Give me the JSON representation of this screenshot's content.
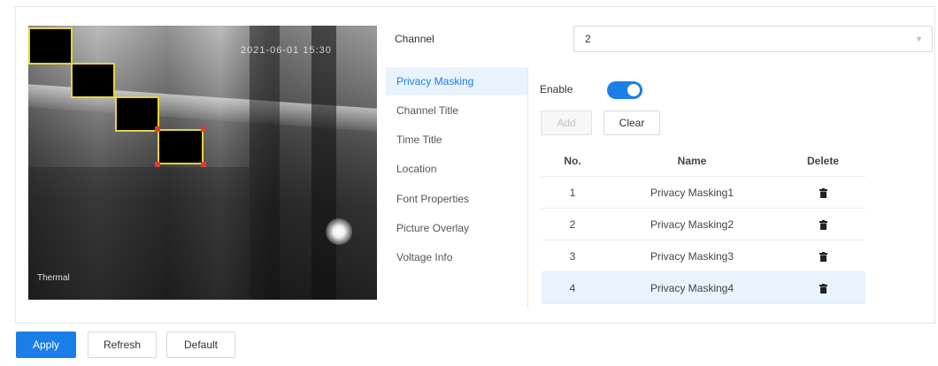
{
  "preview": {
    "osd_time": "2021-06-01 15:30",
    "osd_name": "Thermal",
    "masks": [
      "mask-1",
      "mask-2",
      "mask-3",
      "mask-4"
    ]
  },
  "channel": {
    "label": "Channel",
    "value": "2"
  },
  "menu": {
    "items": [
      {
        "label": "Privacy Masking",
        "active": true
      },
      {
        "label": "Channel Title",
        "active": false
      },
      {
        "label": "Time Title",
        "active": false
      },
      {
        "label": "Location",
        "active": false
      },
      {
        "label": "Font Properties",
        "active": false
      },
      {
        "label": "Picture Overlay",
        "active": false
      },
      {
        "label": "Voltage Info",
        "active": false
      }
    ]
  },
  "privacy": {
    "enable_label": "Enable",
    "enabled": true,
    "add_label": "Add",
    "clear_label": "Clear",
    "columns": [
      "No.",
      "Name",
      "Delete"
    ],
    "rows": [
      {
        "no": "1",
        "name": "Privacy Masking1",
        "delete_icon": "trash-icon"
      },
      {
        "no": "2",
        "name": "Privacy Masking2",
        "delete_icon": "trash-icon"
      },
      {
        "no": "3",
        "name": "Privacy Masking3",
        "delete_icon": "trash-icon"
      },
      {
        "no": "4",
        "name": "Privacy Masking4",
        "delete_icon": "trash-icon",
        "selected": true
      }
    ]
  },
  "footer": {
    "apply_label": "Apply",
    "refresh_label": "Refresh",
    "default_label": "Default"
  },
  "colors": {
    "accent": "#1a7ee8",
    "mask_border": "#e8d23a",
    "handle": "#e53935"
  }
}
